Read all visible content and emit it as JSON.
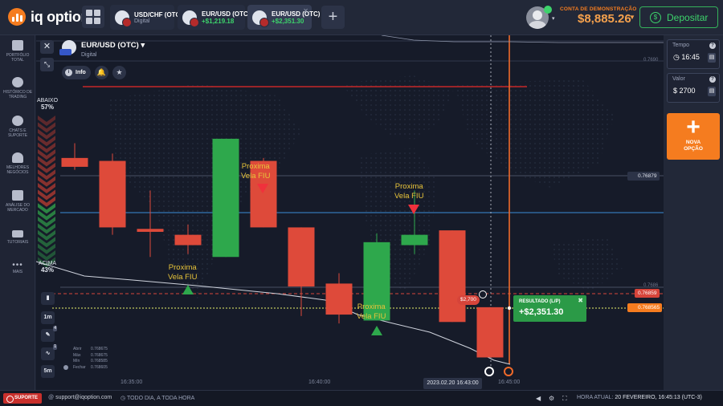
{
  "brand": {
    "name": "iq option"
  },
  "tabs": [
    {
      "title": "USD/CHF (OTC)",
      "sub": "Digital",
      "active": false
    },
    {
      "title": "EUR/USD (OTC)",
      "sub": "+$1,219.18",
      "active": false
    },
    {
      "title": "EUR/USD (OTC)",
      "sub": "+$2,351.30",
      "active": true
    }
  ],
  "account": {
    "label": "CONTA DE DEMONSTRAÇÃO",
    "balance": "$8,885.26",
    "deposit_label": "Depositar"
  },
  "sidebar": {
    "items": [
      {
        "label": "PORTFÓLIO TOTAL",
        "icon": "briefcase-icon"
      },
      {
        "label": "HISTÓRICO DE TRADING",
        "icon": "history-icon"
      },
      {
        "label": "CHATS E SUPORTE",
        "icon": "chat-icon"
      },
      {
        "label": "MELHORES NEGÓCIOS",
        "icon": "trophy-icon"
      },
      {
        "label": "ANÁLISE DO MERCADO",
        "icon": "news-icon"
      },
      {
        "label": "TUTORIAIS",
        "icon": "graduation-cap-icon"
      },
      {
        "label": "MAIS",
        "icon": "more-dots-icon"
      }
    ]
  },
  "asset": {
    "name": "EUR/USD (OTC)",
    "type": "Digital",
    "info_label": "Info"
  },
  "sentiment": {
    "down_label": "ABAIXO",
    "down_pct": "57%",
    "up_label": "ACIMA",
    "up_pct": "43%"
  },
  "chart_controls": {
    "timeframe": "1m",
    "candle_size": "5m",
    "badge_a": "4",
    "badge_b": "1"
  },
  "ohlc": {
    "labels": [
      "Abrir",
      "Máx",
      "Mín",
      "Fechar"
    ],
    "values": [
      "0.768675",
      "0.768675",
      "0.768585",
      "0.768605"
    ]
  },
  "price_tags": {
    "top_grid": "0.7690",
    "level_high": "0.76879",
    "grid_mid": "0.7686",
    "current": "0.76859",
    "strike": "0.768565"
  },
  "trade": {
    "stake": "$2,700",
    "result_label": "RESULTADO (L/P)",
    "result_value": "+$2,351.30"
  },
  "time_axis": {
    "labels": [
      "16:35:00",
      "16:40:00",
      "16:45:00"
    ],
    "current": "2023.02.20 16:43:00"
  },
  "annotations": [
    {
      "text": "Proxima\nVela FIU",
      "direction": "down"
    },
    {
      "text": "Proxima\nVela FIU",
      "direction": "down"
    },
    {
      "text": "Proxima\nVela FIU",
      "direction": "up"
    },
    {
      "text": "Proxima\nVela FIU",
      "direction": "up"
    }
  ],
  "right_panel": {
    "time_label": "Tempo",
    "time_value": "16:45",
    "amount_label": "Valor",
    "amount_value": "$  2700",
    "new_option_label": "NOVA OPÇÃO"
  },
  "bottom": {
    "support_label": "SUPORTE",
    "email": "support@iqoption.com",
    "hours": "TODO DIA, A TODA HORA",
    "clock_label": "HORA ATUAL:",
    "clock_value": "20 FEVEREIRO, 16:45:13 (UTC-3)"
  },
  "colors": {
    "bull": "#2ea84c",
    "bear": "#de4a3a",
    "accent": "#f57c1f",
    "annotation": "#e8c43a"
  },
  "chart_data": {
    "type": "candlestick",
    "candles": [
      {
        "o": 0.76877,
        "c": 0.76871,
        "h": 0.76887,
        "l": 0.76869
      },
      {
        "o": 0.76875,
        "c": 0.7683,
        "h": 0.7688,
        "l": 0.76825
      },
      {
        "o": 0.76829,
        "c": 0.76827,
        "h": 0.76855,
        "l": 0.7681
      },
      {
        "o": 0.76825,
        "c": 0.76818,
        "h": 0.76832,
        "l": 0.76812
      },
      {
        "o": 0.7681,
        "c": 0.7689,
        "h": 0.7689,
        "l": 0.7681
      },
      {
        "o": 0.76875,
        "c": 0.7683,
        "h": 0.76877,
        "l": 0.7683
      },
      {
        "o": 0.7683,
        "c": 0.7679,
        "h": 0.7683,
        "l": 0.7677
      },
      {
        "o": 0.76792,
        "c": 0.76771,
        "h": 0.76799,
        "l": 0.76765
      },
      {
        "o": 0.76767,
        "c": 0.7682,
        "h": 0.76826,
        "l": 0.76767
      },
      {
        "o": 0.76818,
        "c": 0.76825,
        "h": 0.76855,
        "l": 0.76812
      },
      {
        "o": 0.76828,
        "c": 0.76766,
        "h": 0.76828,
        "l": 0.76766
      },
      {
        "o": 0.76776,
        "c": 0.76742,
        "h": 0.76776,
        "l": 0.76742
      }
    ],
    "ylim": [
      0.7672,
      0.7696
    ]
  }
}
